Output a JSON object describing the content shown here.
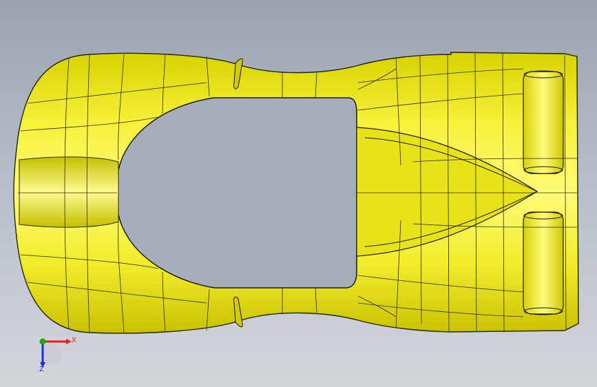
{
  "viewport": {
    "background_top": "#9aa3b0",
    "background_bottom": "#d3d7dc"
  },
  "model": {
    "view": "top",
    "display": "shaded-with-edges",
    "surface_color": "#f4f02a",
    "edge_color": "#1a1a00"
  },
  "triad": {
    "x_label": "X",
    "z_label": "Z",
    "x_color": "#e0201a",
    "y_color": "#19a81c",
    "z_color": "#1c2bd6"
  }
}
